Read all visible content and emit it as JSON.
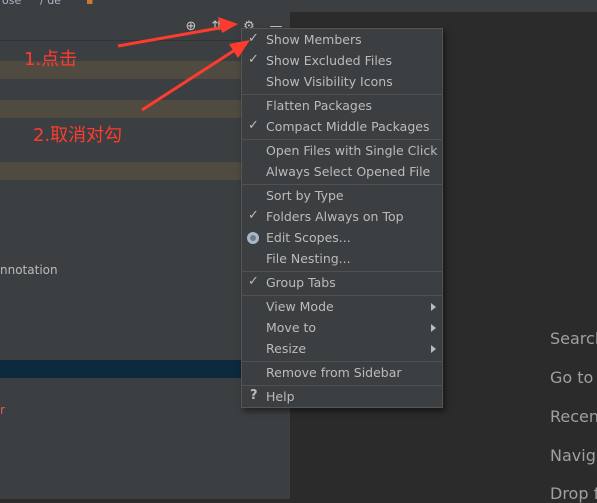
{
  "menu": {
    "items": [
      {
        "label": "Show Members",
        "checked": true
      },
      {
        "label": "Show Excluded Files",
        "checked": true
      },
      {
        "label": "Show Visibility Icons",
        "checked": false
      },
      {
        "label": "Flatten Packages",
        "checked": false
      },
      {
        "label": "Compact Middle Packages",
        "checked": true
      },
      {
        "label": "Open Files with Single Click",
        "checked": false
      },
      {
        "label": "Always Select Opened File",
        "checked": false
      },
      {
        "label": "Sort by Type",
        "checked": false
      },
      {
        "label": "Folders Always on Top",
        "checked": true
      },
      {
        "label": "Edit Scopes...",
        "radio": true
      },
      {
        "label": "File Nesting...",
        "checked": false
      },
      {
        "label": "Group Tabs",
        "checked": true
      },
      {
        "label": "View Mode",
        "submenu": true
      },
      {
        "label": "Move to",
        "submenu": true
      },
      {
        "label": "Resize",
        "submenu": true
      },
      {
        "label": "Remove from Sidebar"
      },
      {
        "label": "Help",
        "help": true
      }
    ],
    "check_glyph": "✓",
    "help_glyph": "?"
  },
  "tree": {
    "partial_text": "nnotation",
    "red_fragment": "r"
  },
  "editor": {
    "hints": [
      "Search",
      "Go to",
      "Recent",
      "Naviga",
      "Drop f"
    ]
  },
  "annotations": {
    "step1": "1.点击",
    "step2": "2.取消对勾"
  },
  "colors": {
    "annotation": "#ff3b2f",
    "panel": "#3c3f41",
    "editor": "#2b2b2b",
    "selection": "#0d293e"
  }
}
